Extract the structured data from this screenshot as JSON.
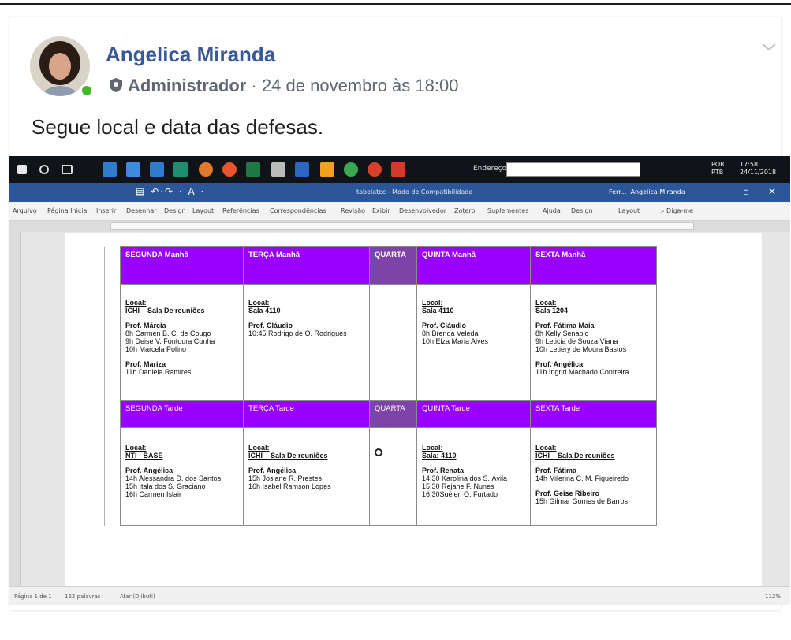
{
  "post": {
    "author": "Angelica Miranda",
    "role": "Administrador",
    "separator": "·",
    "timestamp": "24 de novembro às 18:00",
    "text": "Segue local e data das defesas.",
    "online_color": "#42b72a",
    "author_color": "#385898"
  },
  "screenshot": {
    "taskbar": {
      "address_label": "Endereço",
      "tray_lang_1": "POR",
      "tray_lang_2": "PTB",
      "tray_time": "17:58",
      "tray_date": "24/11/2018"
    },
    "titlebar": {
      "doc_title": "tabelatcc - Modo de Compatibilidade",
      "user_short": "Ferr...",
      "user_name": "Angelica Miranda"
    },
    "ribbon_tabs": [
      "Arquivo",
      "Página Inicial",
      "Inserir",
      "Desenhar",
      "Design",
      "Layout",
      "Referências",
      "Correspondências",
      "Revisão",
      "Exibir",
      "Desenvolvedor",
      "Zotero",
      "Suplementes",
      "Ajuda",
      "Design",
      "Layout"
    ],
    "tell_me": "Diga-me",
    "status": {
      "page": "Página 1 de 1",
      "words": "162 palavras",
      "lang": "Afar (Djibuti)",
      "zoom": "112%"
    },
    "table": {
      "morning_headers": [
        "SEGUNDA Manhã",
        "TERÇA Manhã",
        "QUARTA",
        "QUINTA Manhã",
        "SEXTA Manhã"
      ],
      "afternoon_headers": [
        "SEGUNDA Tarde",
        "TERÇA Tarde",
        "QUARTA",
        "QUINTA Tarde",
        "SEXTA Tarde"
      ],
      "local_label": "Local:",
      "morning": {
        "seg": {
          "place": "ICHI – Sala De reuniões",
          "prof1": "Prof. Márcia",
          "l1": "8h Carmen B. C. de Cougo",
          "l2": "9h Deise V. Fontoura Cunha",
          "l3": "10h Marcela Polino",
          "prof2": "Prof. Mariza",
          "l4": "11h Daniela Ramires"
        },
        "ter": {
          "place": "Sala 4110",
          "prof1": "Prof. Cláudio",
          "l1": "10:45 Rodrigo de O. Rodrigues"
        },
        "qui": {
          "place": "Sala 4110",
          "prof1": "Prof. Cláudio",
          "l1": "8h Brenda Veleda",
          "l2": "10h Elza Maria Alves"
        },
        "sex": {
          "place": "Sala 1204",
          "prof1": "Prof. Fátima Maia",
          "l1": "8h  Kelly Senabio",
          "l2": "9h  Leticia de Souza Viana",
          "l3": "10h Letiery de Moura Bastos",
          "prof2": "Prof. Angélica",
          "l4": "11h Ingrid Machado Contreira"
        }
      },
      "afternoon": {
        "seg": {
          "place": "NTI - BASE",
          "prof1": "Prof. Angélica",
          "l1": "14h Alessandra D. dos Santos",
          "l2": "15h Itala  dos S. Graciano",
          "l3": "16h Carmen Islair"
        },
        "ter": {
          "place": "ICHI – Sala De reuniões",
          "prof1": "Prof. Angélica",
          "l1": "15h Josiane R. Prestes",
          "l2": "16h Isabel Ramson Lopes"
        },
        "qui": {
          "place": "Sala: 4110",
          "prof1": "Prof. Renata",
          "l1": "14:30 Karolina dos S.  Ávila",
          "l2": "15:30 Rejane F. Nunes",
          "l3": "16:30Suélen O.  Furtado"
        },
        "sex": {
          "place": "ICHI – Sala De reuniões",
          "prof1": "Prof. Fátima",
          "l1": "14h Milenna C.  M.  Figueiredo",
          "prof2": "Prof. Geise Ribeiro",
          "l2": "15h Gilmar Gomes de Barros"
        }
      },
      "header_color": "#9900ff",
      "quarta_color": "#7e43a8"
    }
  }
}
